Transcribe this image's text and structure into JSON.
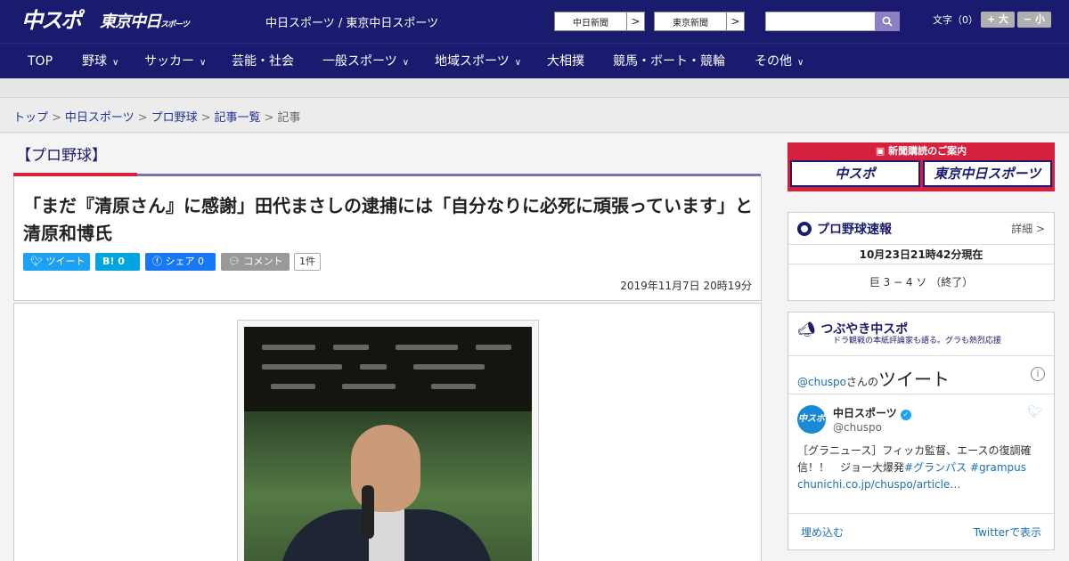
{
  "header": {
    "logo_chuspo": "中スポ",
    "logo_tokyo": "東京中日",
    "logo_tokyo_small": "スポーツ",
    "site_title": "中日スポーツ / 東京中日スポーツ",
    "newspaper_links": [
      "中日新聞",
      "東京新聞"
    ],
    "arrow": ">",
    "font_size_label": "文字（0）",
    "font_larger": "+ 大",
    "font_smaller": "− 小"
  },
  "nav": {
    "items": [
      {
        "label": "TOP",
        "chevron": false
      },
      {
        "label": "野球",
        "chevron": true
      },
      {
        "label": "サッカー",
        "chevron": true
      },
      {
        "label": "芸能・社会",
        "chevron": false
      },
      {
        "label": "一般スポーツ",
        "chevron": true
      },
      {
        "label": "地域スポーツ",
        "chevron": true
      },
      {
        "label": "大相撲",
        "chevron": false
      },
      {
        "label": "競馬・ボート・競輪",
        "chevron": false
      },
      {
        "label": "その他",
        "chevron": true
      }
    ]
  },
  "breadcrumb": {
    "items": [
      "トップ",
      "中日スポーツ",
      "プロ野球",
      "記事一覧"
    ],
    "current": "記事",
    "separator": ">"
  },
  "article": {
    "category": "【プロ野球】",
    "headline": "「まだ『清原さん』に感謝」田代まさしの逮捕には「自分なりに必死に頑張っています」と清原和博氏",
    "share": {
      "tweet": "ツイート",
      "hatebu": "B!",
      "hatebu_count": "0",
      "facebook": "シェア",
      "facebook_count": "0",
      "comment": "コメント",
      "comment_count": "1件"
    },
    "date": "2019年11月7日 20時19分"
  },
  "sidebar": {
    "subscribe": {
      "title": "新聞購読のご案内",
      "logos": [
        "中スポ",
        "東京中日スポーツ"
      ]
    },
    "baseball": {
      "title": "プロ野球速報",
      "detail_link": "詳細 >",
      "timestamp": "10月23日21時42分現在",
      "score": "巨 3 − 4 ソ （終了）"
    },
    "tweets": {
      "title": "つぶやき中スポ",
      "subtitle": "ドラ観戦の本紙評論家も語る。グラも熱烈応援",
      "handle": "@chuspo",
      "handle_suffix": "さんの",
      "heading": "ツイート",
      "info": "i",
      "avatar_text": "中スポ",
      "account_name": "中日スポーツ",
      "verified": "✓",
      "account_id": "@chuspo",
      "text_plain": "［グラニュース］フィッカ監督、エースの復調確信！！　ジョー大爆発",
      "hashtags": "#グランパス #grampus",
      "link": "chunichi.co.jp/chuspo/article…",
      "embed": "埋め込む",
      "view_on_twitter": "Twitterで表示"
    }
  },
  "colors": {
    "brand_navy": "#1a1a6e",
    "accent_red": "#d6213e",
    "tab_line": "#7a72b4",
    "twitter_blue": "#1da1f2",
    "facebook_blue": "#1877f2"
  }
}
